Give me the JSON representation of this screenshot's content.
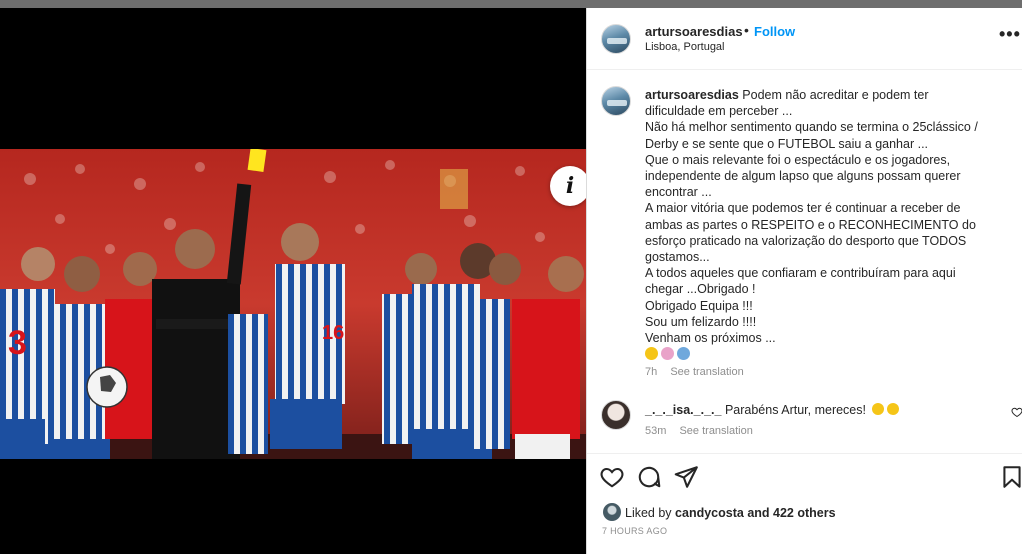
{
  "post": {
    "username": "artursoaresdias",
    "follow_label": "Follow",
    "location": "Lisboa, Portugal",
    "more_label": "•••",
    "info_label": "i"
  },
  "caption": {
    "username": "artursoaresdias",
    "lines": [
      "Podem não acreditar e podem ter",
      "dificuldade em perceber ...",
      "Não há melhor sentimento quando se termina o 25clássico /",
      "Derby e se sente que o FUTEBOL saiu a ganhar ...",
      "Que o mais relevante foi o espectáculo e os jogadores,",
      "independente de algum lapso que alguns possam querer",
      "encontrar ...",
      "A maior vitória que podemos ter é continuar a receber de",
      "ambas as partes o RESPEITO e o RECONHECIMENTO do",
      "esforço praticado na valorização do desporto que TODOS",
      "gostamos...",
      "A todos aqueles que confiaram e contribuíram para aqui",
      "chegar ...Obrigado !",
      "Obrigado Equipa !!!",
      "Sou um felizardo !!!!",
      "Venham os próximos ..."
    ],
    "emojis": [
      "flexed-biceps",
      "ribbon",
      "soccer-ball"
    ],
    "time": "7h",
    "see_translation": "See translation"
  },
  "comment": {
    "username": "_._._isa._._._",
    "text": "Parabéns Artur, mereces!",
    "time": "53m",
    "see_translation": "See translation"
  },
  "likes": {
    "prefix": "Liked by",
    "user": "candycosta",
    "suffix": "and 422 others"
  },
  "timestamp": "7 HOURS AGO",
  "colors": {
    "link_blue": "#0095f6",
    "text": "#262626",
    "muted": "#8e8e8e",
    "porto_blue": "#1c4fa0",
    "benfica_red": "#d7141a",
    "yellow_card": "#ffe51f"
  },
  "icons": [
    "info-icon",
    "more-icon",
    "heart-icon",
    "comment-icon",
    "share-icon",
    "bookmark-icon"
  ]
}
